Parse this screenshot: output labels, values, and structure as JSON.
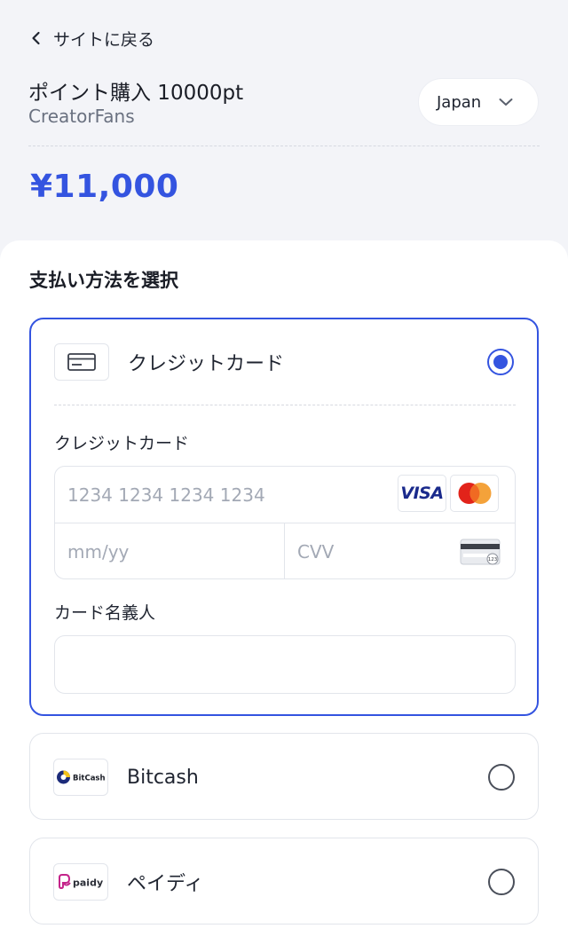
{
  "header": {
    "back_label": "サイトに戻る",
    "product_title": "ポイント購入 10000pt",
    "merchant": "CreatorFans",
    "country": "Japan",
    "price": "¥11,000"
  },
  "payment": {
    "section_title": "支払い方法を選択",
    "methods": [
      {
        "label": "クレジットカード",
        "logo": "credit-card-icon",
        "selected": true
      },
      {
        "label": "Bitcash",
        "logo_text": "BitCash",
        "selected": false
      },
      {
        "label": "ペイディ",
        "logo_text": "paidy",
        "selected": false
      }
    ],
    "card_form": {
      "card_label": "クレジットカード",
      "card_number_placeholder": "1234 1234 1234 1234",
      "expiry_placeholder": "mm/yy",
      "cvv_placeholder": "CVV",
      "visa_text": "VISA",
      "cvv_badge": "123",
      "holder_label": "カード名義人",
      "holder_value": ""
    }
  },
  "colors": {
    "accent": "#3454e0",
    "background": "#f3f4f8",
    "border": "#e2e5eb"
  }
}
